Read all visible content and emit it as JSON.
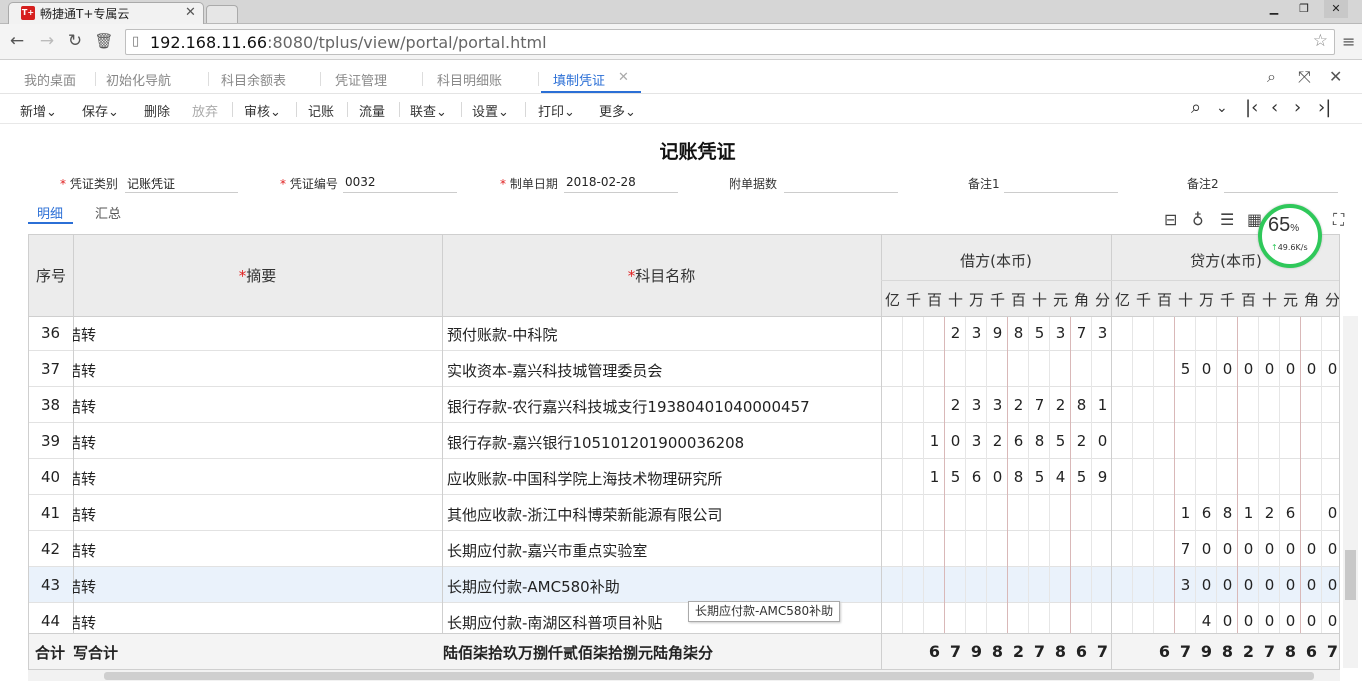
{
  "browser": {
    "tab_title": "畅捷通T+专属云",
    "tab_logo": "T+",
    "url_host": "192.168.11.66",
    "url_rest": ":8080/tplus/view/portal/portal.html"
  },
  "app_tabs": [
    {
      "label": "我的桌面"
    },
    {
      "label": "初始化导航"
    },
    {
      "label": "科目余额表"
    },
    {
      "label": "凭证管理"
    },
    {
      "label": "科目明细账"
    },
    {
      "label": "填制凭证"
    }
  ],
  "toolbar": {
    "new": "新增",
    "save": "保存",
    "delete": "删除",
    "discard": "放弃",
    "audit": "审核",
    "post": "记账",
    "flow": "流量",
    "query": "联查",
    "settings": "设置",
    "print": "打印",
    "more": "更多"
  },
  "voucher": {
    "title": "记账凭证",
    "type_label": "凭证类别",
    "type_value": "记账凭证",
    "number_label": "凭证编号",
    "number_value": "0032",
    "date_label": "制单日期",
    "date_value": "2018-02-28",
    "attach_label": "附单据数",
    "remark1_label": "备注1",
    "remark2_label": "备注2"
  },
  "subtabs": {
    "detail": "明细",
    "summary": "汇总"
  },
  "speed": {
    "percent": "65",
    "unit": "%",
    "rate": "49.6K/s"
  },
  "grid": {
    "headers": {
      "seq": "序号",
      "summary": "摘要",
      "account": "科目名称",
      "debit": "借方(本币)",
      "credit": "贷方(本币)"
    },
    "digit_units": [
      "亿",
      "千",
      "百",
      "十",
      "万",
      "千",
      "百",
      "十",
      "元",
      "角",
      "分"
    ],
    "rows": [
      {
        "seq": "36",
        "summary": "结转",
        "account": "预付账款-中科院",
        "debit": "23985373",
        "credit": ""
      },
      {
        "seq": "37",
        "summary": "结转",
        "account": "实收资本-嘉兴科技城管理委员会",
        "debit": "",
        "credit": "50000000"
      },
      {
        "seq": "38",
        "summary": "结转",
        "account": "银行存款-农行嘉兴科技城支行19380401040000457",
        "debit": "23327281",
        "credit": ""
      },
      {
        "seq": "39",
        "summary": "结转",
        "account": "银行存款-嘉兴银行105101201900036208",
        "debit": "103268520",
        "credit": ""
      },
      {
        "seq": "40",
        "summary": "结转",
        "account": "应收账款-中国科学院上海技术物理研究所",
        "debit": "156085459",
        "credit": ""
      },
      {
        "seq": "41",
        "summary": "结转",
        "account": "其他应收款-浙江中科博荣新能源有限公司",
        "debit": "",
        "credit": "168126 0"
      },
      {
        "seq": "42",
        "summary": "结转",
        "account": "长期应付款-嘉兴市重点实验室",
        "debit": "",
        "credit": "70000000"
      },
      {
        "seq": "43",
        "summary": "结转",
        "account": "长期应付款-AMC580补助",
        "debit": "",
        "credit": "30000000"
      },
      {
        "seq": "44",
        "summary": "结转",
        "account": "长期应付款-南湖区科普项目补贴",
        "debit": "",
        "credit": "4000000"
      }
    ],
    "footer": {
      "label": "合计",
      "summary": "写合计",
      "words": "陆佰柒拾玖万捌仟贰佰柒拾捌元陆角柒分",
      "debit": "679827867",
      "credit": "679827867"
    }
  },
  "tooltip": "长期应付款-AMC580补助"
}
